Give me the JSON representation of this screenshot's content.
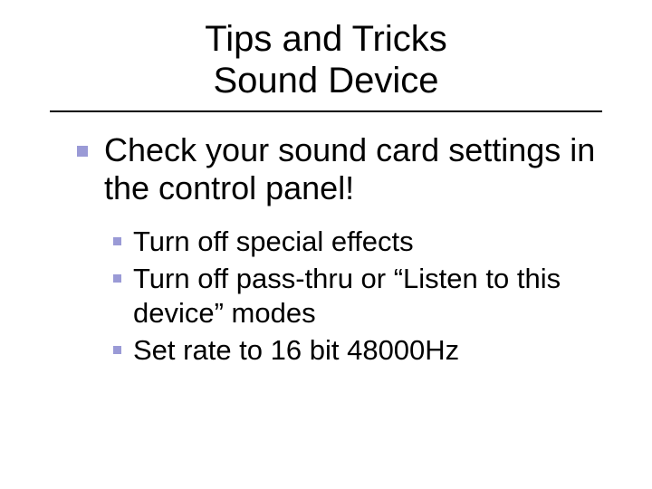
{
  "title": {
    "line1": "Tips and Tricks",
    "line2": "Sound Device"
  },
  "bullets": {
    "main": "Check your sound card settings in the control panel!",
    "subs": [
      "Turn off special effects",
      "Turn off pass-thru or “Listen to this device” modes",
      "Set rate to 16 bit 48000Hz"
    ]
  }
}
